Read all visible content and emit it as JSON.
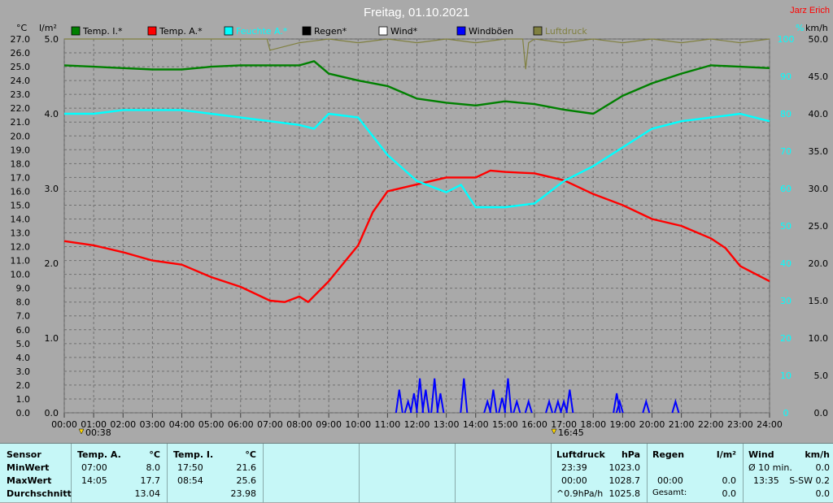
{
  "header": {
    "title": "Freitag, 01.10.2021",
    "author": "Jarz Erich",
    "unit_left_1": "°C",
    "unit_left_2": "l/m²",
    "unit_right_1": "%",
    "unit_right_2": "km/h"
  },
  "legend": [
    {
      "label": "Temp. I.*",
      "color": "#008000"
    },
    {
      "label": "Temp. A.*",
      "color": "#ff0000"
    },
    {
      "label": "Feuchte A.*",
      "color": "#00ffff"
    },
    {
      "label": "Regen*",
      "color": "#000000"
    },
    {
      "label": "Wind*",
      "color": "#ffffff"
    },
    {
      "label": "Windböen",
      "color": "#0000ff"
    },
    {
      "label": "Luftdruck",
      "color": "#808040"
    }
  ],
  "markers": [
    {
      "label": "00:38"
    },
    {
      "label": "16:45"
    }
  ],
  "chart_data": {
    "type": "line",
    "x_ticks": [
      "00:00",
      "01:00",
      "02:00",
      "03:00",
      "04:00",
      "05:00",
      "06:00",
      "07:00",
      "08:00",
      "09:00",
      "10:00",
      "11:00",
      "12:00",
      "13:00",
      "14:00",
      "15:00",
      "16:00",
      "17:00",
      "18:00",
      "19:00",
      "20:00",
      "21:00",
      "22:00",
      "23:00",
      "24:00"
    ],
    "xlim": [
      0,
      24
    ],
    "axes": {
      "temp_ticks": [
        "0.0",
        "1.0",
        "2.0",
        "3.0",
        "4.0",
        "5.0",
        "6.0",
        "7.0",
        "8.0",
        "9.0",
        "10.0",
        "11.0",
        "12.0",
        "13.0",
        "14.0",
        "15.0",
        "16.0",
        "17.0",
        "18.0",
        "19.0",
        "20.0",
        "21.0",
        "22.0",
        "23.0",
        "24.0",
        "25.0",
        "26.0",
        "27.0"
      ],
      "temp_range": [
        0,
        27
      ],
      "rain_ticks": [
        "0.0",
        "1.0",
        "2.0",
        "3.0",
        "4.0",
        "5.0"
      ],
      "rain_range": [
        0,
        5
      ],
      "humidity_ticks": [
        "0",
        "10",
        "20",
        "30",
        "40",
        "50",
        "60",
        "70",
        "80",
        "90",
        "100"
      ],
      "humidity_range": [
        0,
        100
      ],
      "wind_ticks": [
        "0.0",
        "5.0",
        "10.0",
        "15.0",
        "20.0",
        "25.0",
        "30.0",
        "35.0",
        "40.0",
        "45.0",
        "50.0"
      ],
      "wind_range": [
        0,
        50
      ]
    },
    "series": [
      {
        "name": "Temp. I.*",
        "axis": "temp",
        "color": "#008000",
        "x": [
          0,
          1,
          2,
          3,
          4,
          5,
          6,
          7,
          8,
          8.5,
          9,
          10,
          11,
          12,
          13,
          14,
          15,
          16,
          17,
          18,
          19,
          20,
          21,
          22,
          23,
          24
        ],
        "y": [
          25.1,
          25.0,
          24.9,
          24.8,
          24.8,
          25.0,
          25.1,
          25.1,
          25.1,
          25.4,
          24.5,
          24.0,
          23.6,
          22.7,
          22.4,
          22.2,
          22.5,
          22.3,
          21.9,
          21.6,
          22.9,
          23.8,
          24.5,
          25.1,
          25.0,
          24.9
        ]
      },
      {
        "name": "Temp. A.*",
        "axis": "temp",
        "color": "#ff0000",
        "x": [
          0,
          1,
          2,
          3,
          4,
          5,
          6,
          7,
          7.5,
          8,
          8.3,
          9,
          10,
          10.5,
          11,
          12,
          13,
          14,
          14.5,
          15,
          16,
          17,
          18,
          19,
          20,
          21,
          22,
          22.5,
          23,
          24
        ],
        "y": [
          12.4,
          12.1,
          11.6,
          11.0,
          10.7,
          9.8,
          9.1,
          8.1,
          8.0,
          8.4,
          8.0,
          9.5,
          12.1,
          14.5,
          16.0,
          16.5,
          17.0,
          17.0,
          17.5,
          17.4,
          17.3,
          16.8,
          15.8,
          15.0,
          14.0,
          13.5,
          12.6,
          11.9,
          10.6,
          9.5
        ]
      },
      {
        "name": "Feuchte A.*",
        "axis": "humidity",
        "color": "#00ffff",
        "x": [
          0,
          1,
          2,
          3,
          4,
          5,
          6,
          7,
          8,
          8.5,
          9,
          10,
          11,
          12,
          13,
          13.5,
          14,
          15,
          16,
          17,
          18,
          19,
          20,
          21,
          22,
          23,
          24
        ],
        "y": [
          80,
          80,
          81,
          81,
          81,
          80,
          79,
          78,
          77,
          76,
          80,
          79,
          69,
          62,
          59,
          61,
          55,
          55,
          56,
          62,
          66,
          71,
          76,
          78,
          79,
          80,
          78
        ]
      },
      {
        "name": "Windböen",
        "axis": "wind",
        "type": "bar",
        "color": "#0000ff",
        "x": [
          11.4,
          11.7,
          11.9,
          12.1,
          12.3,
          12.6,
          12.8,
          13.6,
          14.4,
          14.6,
          14.9,
          15.1,
          15.4,
          15.8,
          16.5,
          16.8,
          17.0,
          17.2,
          18.8,
          18.9,
          19.8,
          20.8
        ],
        "y": [
          3.1,
          1.5,
          2.6,
          4.6,
          3.1,
          4.6,
          2.6,
          4.6,
          1.5,
          3.1,
          2.0,
          4.6,
          1.5,
          1.5,
          1.5,
          1.5,
          1.5,
          3.1,
          2.6,
          1.5,
          1.5,
          1.5
        ]
      },
      {
        "name": "Luftdruck",
        "axis": "humidity",
        "color": "#808040",
        "x": [
          0,
          6.9,
          7,
          8,
          9,
          10,
          11,
          12,
          13,
          14,
          15,
          15.6,
          15.7,
          15.8,
          16,
          17,
          18,
          19,
          20,
          21,
          22,
          23,
          24
        ],
        "y": [
          100,
          100,
          97,
          99,
          100,
          99,
          100,
          99,
          100,
          99,
          100,
          100,
          92,
          99,
          100,
          99,
          100,
          99,
          100,
          99,
          100,
          99,
          100
        ]
      }
    ]
  },
  "stats": {
    "sensor": {
      "head": "Sensor",
      "rows": [
        "MinWert",
        "MaxWert",
        "Durchschnitt"
      ]
    },
    "temp_a": {
      "head": "Temp. A.",
      "unit": "°C",
      "rows": [
        [
          "07:00",
          "8.0"
        ],
        [
          "14:05",
          "17.7"
        ],
        [
          "",
          "13.04"
        ]
      ]
    },
    "temp_i": {
      "head": "Temp. I.",
      "unit": "°C",
      "rows": [
        [
          "17:50",
          "21.6"
        ],
        [
          "08:54",
          "25.6"
        ],
        [
          "",
          "23.98"
        ]
      ]
    },
    "luftdruck": {
      "head": "Luftdruck",
      "unit": "hPa",
      "rows": [
        [
          "23:39",
          "1023.0"
        ],
        [
          "00:00",
          "1028.7"
        ],
        [
          "^0.9hPa/h",
          "1025.8"
        ]
      ]
    },
    "regen": {
      "head": "Regen",
      "unit": "l/m²",
      "rows": [
        [
          "",
          ""
        ],
        [
          "00:00",
          "0.0"
        ],
        [
          "Gesamt:",
          "0.0"
        ]
      ]
    },
    "wind": {
      "head": "Wind",
      "unit": "km/h",
      "rows": [
        [
          "Ø 10 min.",
          "0.0"
        ],
        [
          "13:35",
          "S-SW 0.2"
        ],
        [
          "",
          "0.0"
        ]
      ]
    }
  }
}
